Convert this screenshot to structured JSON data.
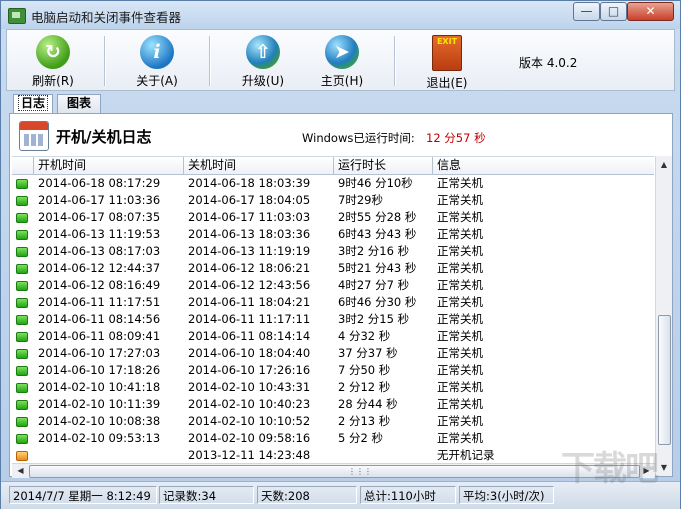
{
  "window": {
    "title": "电脑启动和关闭事件查看器"
  },
  "toolbar": {
    "refresh": "刷新(R)",
    "about": "关于(A)",
    "upgrade": "升级(U)",
    "home": "主页(H)",
    "exit": "退出(E)",
    "exit_icon_text": "EXIT",
    "version": "版本 4.0.2"
  },
  "tabs": {
    "log": "日志",
    "chart": "图表"
  },
  "header": {
    "title": "开机/关机日志",
    "runtime_label": "Windows已运行时间:",
    "runtime_value": "12 分57 秒"
  },
  "table": {
    "columns": [
      "开机时间",
      "关机时间",
      "运行时长",
      "信息"
    ],
    "rows": [
      {
        "start": "2014-06-18 08:17:29",
        "end": "2014-06-18 18:03:39",
        "duration": "9时46 分10秒",
        "info": "正常关机",
        "flag": "green"
      },
      {
        "start": "2014-06-17 11:03:36",
        "end": "2014-06-17 18:04:05",
        "duration": "7时29秒",
        "info": "正常关机",
        "flag": "green"
      },
      {
        "start": "2014-06-17 08:07:35",
        "end": "2014-06-17 11:03:03",
        "duration": "2时55 分28 秒",
        "info": "正常关机",
        "flag": "green"
      },
      {
        "start": "2014-06-13 11:19:53",
        "end": "2014-06-13 18:03:36",
        "duration": "6时43 分43 秒",
        "info": "正常关机",
        "flag": "green"
      },
      {
        "start": "2014-06-13 08:17:03",
        "end": "2014-06-13 11:19:19",
        "duration": "3时2 分16 秒",
        "info": "正常关机",
        "flag": "green"
      },
      {
        "start": "2014-06-12 12:44:37",
        "end": "2014-06-12 18:06:21",
        "duration": "5时21 分43 秒",
        "info": "正常关机",
        "flag": "green"
      },
      {
        "start": "2014-06-12 08:16:49",
        "end": "2014-06-12 12:43:56",
        "duration": "4时27 分7 秒",
        "info": "正常关机",
        "flag": "green"
      },
      {
        "start": "2014-06-11 11:17:51",
        "end": "2014-06-11 18:04:21",
        "duration": "6时46 分30 秒",
        "info": "正常关机",
        "flag": "green"
      },
      {
        "start": "2014-06-11 08:14:56",
        "end": "2014-06-11 11:17:11",
        "duration": "3时2 分15 秒",
        "info": "正常关机",
        "flag": "green"
      },
      {
        "start": "2014-06-11 08:09:41",
        "end": "2014-06-11 08:14:14",
        "duration": "4 分32 秒",
        "info": "正常关机",
        "flag": "green"
      },
      {
        "start": "2014-06-10 17:27:03",
        "end": "2014-06-10 18:04:40",
        "duration": "37 分37 秒",
        "info": "正常关机",
        "flag": "green"
      },
      {
        "start": "2014-06-10 17:18:26",
        "end": "2014-06-10 17:26:16",
        "duration": "7 分50 秒",
        "info": "正常关机",
        "flag": "green"
      },
      {
        "start": "2014-02-10 10:41:18",
        "end": "2014-02-10 10:43:31",
        "duration": "2 分12 秒",
        "info": "正常关机",
        "flag": "green"
      },
      {
        "start": "2014-02-10 10:11:39",
        "end": "2014-02-10 10:40:23",
        "duration": "28 分44 秒",
        "info": "正常关机",
        "flag": "green"
      },
      {
        "start": "2014-02-10 10:08:38",
        "end": "2014-02-10 10:10:52",
        "duration": "2 分13 秒",
        "info": "正常关机",
        "flag": "green"
      },
      {
        "start": "2014-02-10 09:53:13",
        "end": "2014-02-10 09:58:16",
        "duration": "5 分2 秒",
        "info": "正常关机",
        "flag": "green"
      },
      {
        "start": "",
        "end": "2013-12-11 14:23:48",
        "duration": "",
        "info": "无开机记录",
        "flag": "orange"
      }
    ]
  },
  "status": {
    "date": "2014/7/7 星期一 8:12:49",
    "records": "记录数:34",
    "days": "天数:208",
    "total": "总计:110小时",
    "average": "平均:3(小时/次)"
  },
  "watermark": "下载吧",
  "colors": {
    "runtime": "#c00000",
    "flag_green": "#21a316",
    "flag_orange": "#ed8c19"
  }
}
